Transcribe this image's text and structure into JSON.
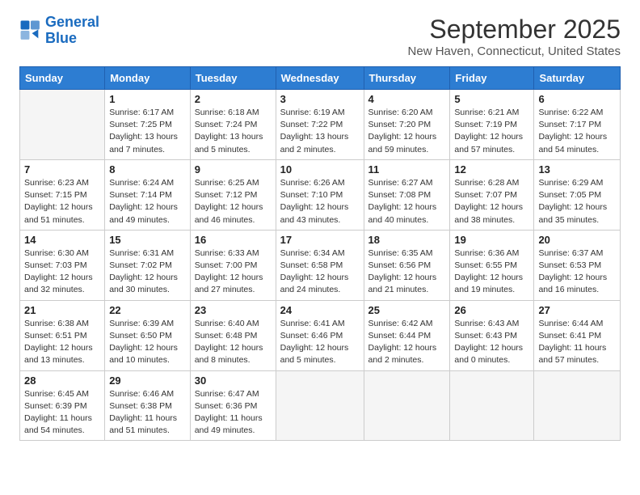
{
  "logo": {
    "line1": "General",
    "line2": "Blue"
  },
  "title": "September 2025",
  "subtitle": "New Haven, Connecticut, United States",
  "days_header": [
    "Sunday",
    "Monday",
    "Tuesday",
    "Wednesday",
    "Thursday",
    "Friday",
    "Saturday"
  ],
  "weeks": [
    [
      {
        "num": "",
        "info": ""
      },
      {
        "num": "1",
        "info": "Sunrise: 6:17 AM\nSunset: 7:25 PM\nDaylight: 13 hours\nand 7 minutes."
      },
      {
        "num": "2",
        "info": "Sunrise: 6:18 AM\nSunset: 7:24 PM\nDaylight: 13 hours\nand 5 minutes."
      },
      {
        "num": "3",
        "info": "Sunrise: 6:19 AM\nSunset: 7:22 PM\nDaylight: 13 hours\nand 2 minutes."
      },
      {
        "num": "4",
        "info": "Sunrise: 6:20 AM\nSunset: 7:20 PM\nDaylight: 12 hours\nand 59 minutes."
      },
      {
        "num": "5",
        "info": "Sunrise: 6:21 AM\nSunset: 7:19 PM\nDaylight: 12 hours\nand 57 minutes."
      },
      {
        "num": "6",
        "info": "Sunrise: 6:22 AM\nSunset: 7:17 PM\nDaylight: 12 hours\nand 54 minutes."
      }
    ],
    [
      {
        "num": "7",
        "info": "Sunrise: 6:23 AM\nSunset: 7:15 PM\nDaylight: 12 hours\nand 51 minutes."
      },
      {
        "num": "8",
        "info": "Sunrise: 6:24 AM\nSunset: 7:14 PM\nDaylight: 12 hours\nand 49 minutes."
      },
      {
        "num": "9",
        "info": "Sunrise: 6:25 AM\nSunset: 7:12 PM\nDaylight: 12 hours\nand 46 minutes."
      },
      {
        "num": "10",
        "info": "Sunrise: 6:26 AM\nSunset: 7:10 PM\nDaylight: 12 hours\nand 43 minutes."
      },
      {
        "num": "11",
        "info": "Sunrise: 6:27 AM\nSunset: 7:08 PM\nDaylight: 12 hours\nand 40 minutes."
      },
      {
        "num": "12",
        "info": "Sunrise: 6:28 AM\nSunset: 7:07 PM\nDaylight: 12 hours\nand 38 minutes."
      },
      {
        "num": "13",
        "info": "Sunrise: 6:29 AM\nSunset: 7:05 PM\nDaylight: 12 hours\nand 35 minutes."
      }
    ],
    [
      {
        "num": "14",
        "info": "Sunrise: 6:30 AM\nSunset: 7:03 PM\nDaylight: 12 hours\nand 32 minutes."
      },
      {
        "num": "15",
        "info": "Sunrise: 6:31 AM\nSunset: 7:02 PM\nDaylight: 12 hours\nand 30 minutes."
      },
      {
        "num": "16",
        "info": "Sunrise: 6:33 AM\nSunset: 7:00 PM\nDaylight: 12 hours\nand 27 minutes."
      },
      {
        "num": "17",
        "info": "Sunrise: 6:34 AM\nSunset: 6:58 PM\nDaylight: 12 hours\nand 24 minutes."
      },
      {
        "num": "18",
        "info": "Sunrise: 6:35 AM\nSunset: 6:56 PM\nDaylight: 12 hours\nand 21 minutes."
      },
      {
        "num": "19",
        "info": "Sunrise: 6:36 AM\nSunset: 6:55 PM\nDaylight: 12 hours\nand 19 minutes."
      },
      {
        "num": "20",
        "info": "Sunrise: 6:37 AM\nSunset: 6:53 PM\nDaylight: 12 hours\nand 16 minutes."
      }
    ],
    [
      {
        "num": "21",
        "info": "Sunrise: 6:38 AM\nSunset: 6:51 PM\nDaylight: 12 hours\nand 13 minutes."
      },
      {
        "num": "22",
        "info": "Sunrise: 6:39 AM\nSunset: 6:50 PM\nDaylight: 12 hours\nand 10 minutes."
      },
      {
        "num": "23",
        "info": "Sunrise: 6:40 AM\nSunset: 6:48 PM\nDaylight: 12 hours\nand 8 minutes."
      },
      {
        "num": "24",
        "info": "Sunrise: 6:41 AM\nSunset: 6:46 PM\nDaylight: 12 hours\nand 5 minutes."
      },
      {
        "num": "25",
        "info": "Sunrise: 6:42 AM\nSunset: 6:44 PM\nDaylight: 12 hours\nand 2 minutes."
      },
      {
        "num": "26",
        "info": "Sunrise: 6:43 AM\nSunset: 6:43 PM\nDaylight: 12 hours\nand 0 minutes."
      },
      {
        "num": "27",
        "info": "Sunrise: 6:44 AM\nSunset: 6:41 PM\nDaylight: 11 hours\nand 57 minutes."
      }
    ],
    [
      {
        "num": "28",
        "info": "Sunrise: 6:45 AM\nSunset: 6:39 PM\nDaylight: 11 hours\nand 54 minutes."
      },
      {
        "num": "29",
        "info": "Sunrise: 6:46 AM\nSunset: 6:38 PM\nDaylight: 11 hours\nand 51 minutes."
      },
      {
        "num": "30",
        "info": "Sunrise: 6:47 AM\nSunset: 6:36 PM\nDaylight: 11 hours\nand 49 minutes."
      },
      {
        "num": "",
        "info": ""
      },
      {
        "num": "",
        "info": ""
      },
      {
        "num": "",
        "info": ""
      },
      {
        "num": "",
        "info": ""
      }
    ]
  ]
}
